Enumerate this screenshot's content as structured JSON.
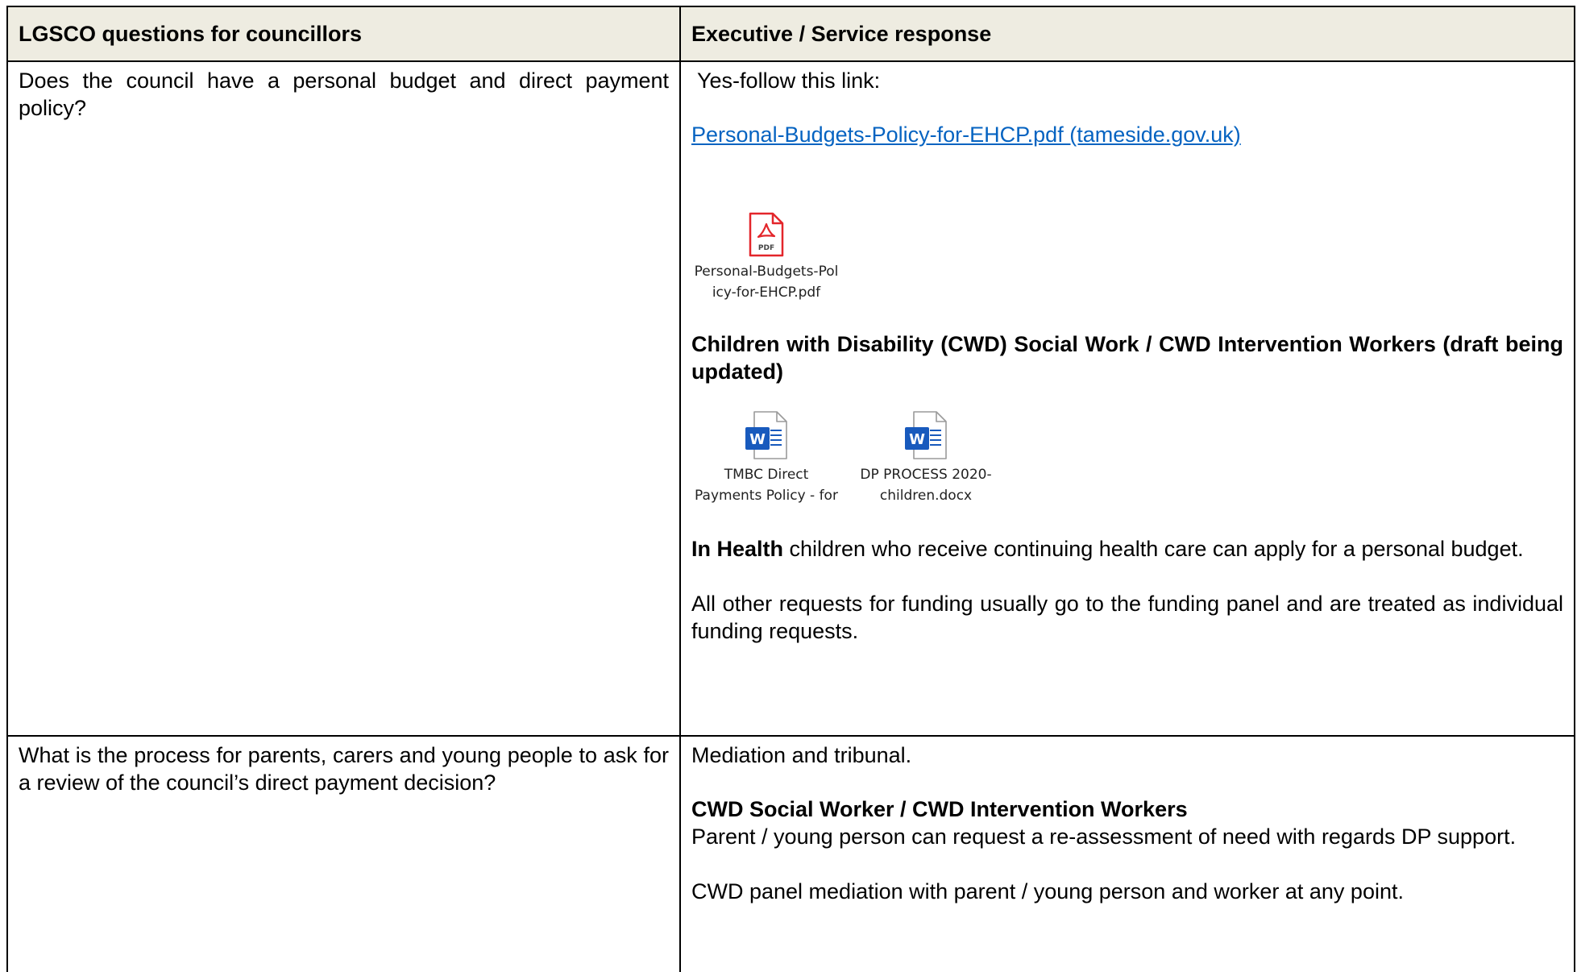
{
  "table": {
    "header": {
      "left": "LGSCO questions for councillors",
      "right": "Executive / Service response"
    },
    "rows": [
      {
        "question": "Does the council have a personal budget and direct payment policy?",
        "response": {
          "intro": " Yes-follow this link:",
          "link": "Personal-Budgets-Policy-for-EHCP.pdf (tameside.gov.uk)",
          "pdf_attachment": {
            "icon": "pdf-file-icon",
            "badge": "PDF",
            "caption": "Personal-Budgets-Pol\nicy-for-EHCP.pdf"
          },
          "cwd_heading": "Children with Disability (CWD) Social Work / CWD Intervention Workers (draft being updated)",
          "word_attachments": [
            {
              "icon": "word-file-icon",
              "badge": "W",
              "caption": "TMBC Direct\nPayments Policy - for"
            },
            {
              "icon": "word-file-icon",
              "badge": "W",
              "caption": "DP PROCESS 2020-\nchildren.docx"
            }
          ],
          "health_bold": "In Health",
          "health_rest": " children who receive continuing health care can apply for a personal budget.",
          "other": "All other requests for funding usually go to the funding panel and are treated as individual funding requests."
        }
      },
      {
        "question": "What is the process for parents, carers and young people to ask for a review of the council’s direct payment decision?",
        "response": {
          "intro": "Mediation and tribunal.",
          "cwd_heading": "CWD Social Worker / CWD Intervention Workers",
          "reassess": "Parent / young person can request a re-assessment of need with regards DP support.",
          "panel": "CWD panel mediation with parent / young person and worker at any point."
        }
      }
    ]
  },
  "colors": {
    "header_bg": "#eeece1",
    "link": "#0563c1",
    "pdf_red": "#e3262b",
    "word_blue": "#185abd"
  }
}
